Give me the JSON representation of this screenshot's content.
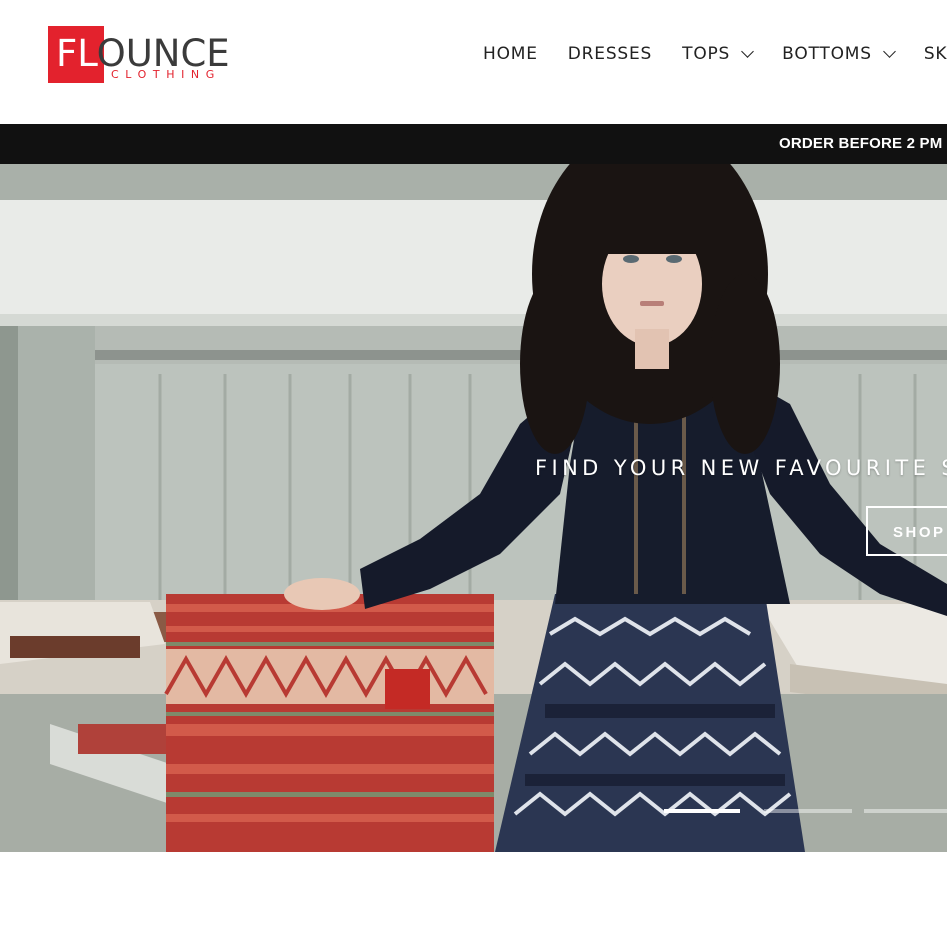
{
  "header": {
    "logo": {
      "highlight": "FL",
      "rest": "OUNCE",
      "subtitle": "CLOTHING",
      "brand_color": "#e3222d"
    },
    "nav": [
      {
        "label": "HOME",
        "has_dropdown": false
      },
      {
        "label": "DRESSES",
        "has_dropdown": false
      },
      {
        "label": "TOPS",
        "has_dropdown": true
      },
      {
        "label": "BOTTOMS",
        "has_dropdown": true
      },
      {
        "label": "SK",
        "has_dropdown": false
      }
    ]
  },
  "announcement": {
    "text": "ORDER BEFORE 2 PM",
    "background": "#111111"
  },
  "hero": {
    "heading": "FIND YOUR NEW FAVOURITE ST",
    "button_label": "SHOP",
    "slides": {
      "count": 3,
      "active_index": 0
    }
  },
  "icons": [
    "chevron-down-icon"
  ]
}
